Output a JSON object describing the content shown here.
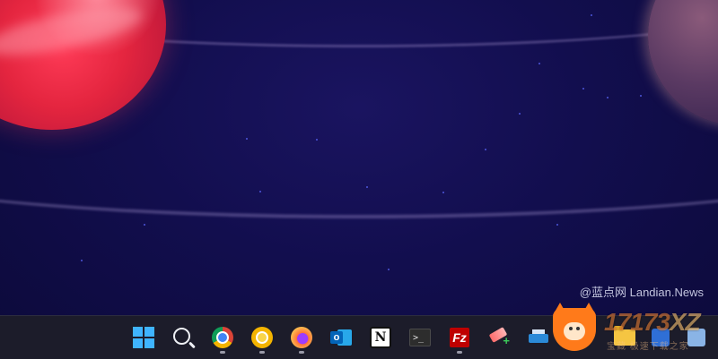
{
  "watermark": {
    "text": "@蓝点网 Landian.News"
  },
  "overlay_logo": {
    "number": "17173",
    "suffix": "XZ",
    "sub": "宝藏 极速下载之家"
  },
  "taskbar": {
    "items": [
      {
        "name": "start-button",
        "icon": "windows-logo-icon",
        "indicator": false
      },
      {
        "name": "search-button",
        "icon": "search-icon",
        "indicator": false
      },
      {
        "name": "chrome-app",
        "icon": "chrome-icon",
        "indicator": true
      },
      {
        "name": "chrome-canary-app",
        "icon": "chrome-canary-icon",
        "indicator": true
      },
      {
        "name": "firefox-app",
        "icon": "firefox-icon",
        "indicator": true
      },
      {
        "name": "outlook-app",
        "icon": "outlook-icon",
        "indicator": false
      },
      {
        "name": "notion-app",
        "icon": "notion-icon",
        "indicator": false
      },
      {
        "name": "terminal-app",
        "icon": "terminal-icon",
        "indicator": false
      },
      {
        "name": "filezilla-app",
        "icon": "filezilla-icon",
        "indicator": true
      },
      {
        "name": "eraser-app",
        "icon": "eraser-icon",
        "indicator": false
      },
      {
        "name": "printer-app",
        "icon": "printer-icon",
        "indicator": false
      }
    ],
    "labels": {
      "outlook": "o",
      "notion": "N",
      "terminal": ">_",
      "filezilla": "Fz",
      "eraser_plus": "+"
    }
  },
  "colors": {
    "desktop_bg": "#120e4e",
    "taskbar_bg": "#1c1c2a",
    "accent_windows": "#3fb4ff"
  }
}
